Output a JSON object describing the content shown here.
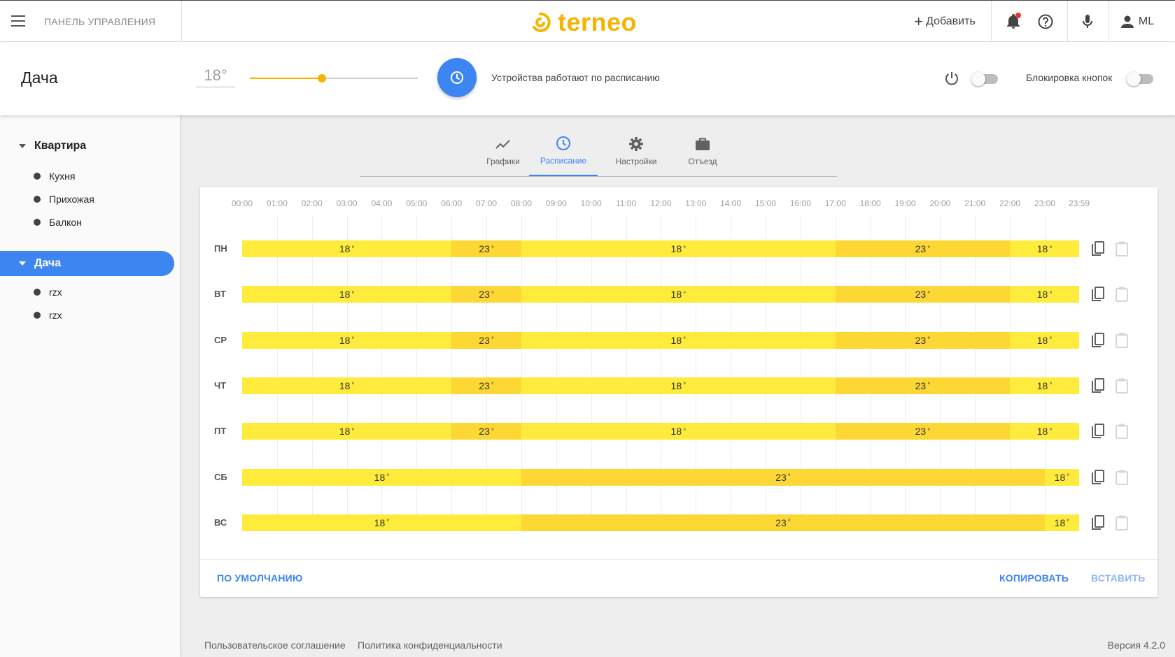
{
  "topbar": {
    "panel_title": "ПАНЕЛЬ УПРАВЛЕНИЯ",
    "brand": "terneo",
    "add_label": "Добавить",
    "user_initials": "ML"
  },
  "header": {
    "group_name": "Дача",
    "set_temperature": "18°",
    "temperature_slider_fraction": 0.43,
    "schedule_status": "Устройства работают по расписанию",
    "power_toggle_on": false,
    "button_lock_label": "Блокировка кнопок",
    "button_lock_on": false
  },
  "sidebar": {
    "groups": [
      {
        "name": "Квартира",
        "active": false,
        "devices": [
          "Кухня",
          "Прихожая",
          "Балкон"
        ]
      },
      {
        "name": "Дача",
        "active": true,
        "devices": [
          "rzx",
          "rzx"
        ]
      }
    ]
  },
  "tabs": [
    {
      "label": "Графики",
      "icon": "chart-icon",
      "active": false
    },
    {
      "label": "Расписание",
      "icon": "clock-icon",
      "active": true
    },
    {
      "label": "Настройки",
      "icon": "gear-icon",
      "active": false
    },
    {
      "label": "Отъезд",
      "icon": "suitcase-icon",
      "active": false
    }
  ],
  "schedule": {
    "hours": [
      "00:00",
      "01:00",
      "02:00",
      "03:00",
      "04:00",
      "05:00",
      "06:00",
      "07:00",
      "08:00",
      "09:00",
      "10:00",
      "11:00",
      "12:00",
      "13:00",
      "14:00",
      "15:00",
      "16:00",
      "17:00",
      "18:00",
      "19:00",
      "20:00",
      "21:00",
      "22:00",
      "23:00",
      "23:59"
    ],
    "colors": {
      "low": "#ffeb3b",
      "high": "#fdd835"
    },
    "days": [
      {
        "label": "ПН",
        "periods": [
          {
            "start": "00:00",
            "end": "06:00",
            "temp": "18"
          },
          {
            "start": "06:00",
            "end": "08:00",
            "temp": "23"
          },
          {
            "start": "08:00",
            "end": "17:00",
            "temp": "18"
          },
          {
            "start": "17:00",
            "end": "22:00",
            "temp": "23"
          },
          {
            "start": "22:00",
            "end": "23:59",
            "temp": "18"
          }
        ]
      },
      {
        "label": "ВТ",
        "periods": [
          {
            "start": "00:00",
            "end": "06:00",
            "temp": "18"
          },
          {
            "start": "06:00",
            "end": "08:00",
            "temp": "23"
          },
          {
            "start": "08:00",
            "end": "17:00",
            "temp": "18"
          },
          {
            "start": "17:00",
            "end": "22:00",
            "temp": "23"
          },
          {
            "start": "22:00",
            "end": "23:59",
            "temp": "18"
          }
        ]
      },
      {
        "label": "СР",
        "periods": [
          {
            "start": "00:00",
            "end": "06:00",
            "temp": "18"
          },
          {
            "start": "06:00",
            "end": "08:00",
            "temp": "23"
          },
          {
            "start": "08:00",
            "end": "17:00",
            "temp": "18"
          },
          {
            "start": "17:00",
            "end": "22:00",
            "temp": "23"
          },
          {
            "start": "22:00",
            "end": "23:59",
            "temp": "18"
          }
        ]
      },
      {
        "label": "ЧТ",
        "periods": [
          {
            "start": "00:00",
            "end": "06:00",
            "temp": "18"
          },
          {
            "start": "06:00",
            "end": "08:00",
            "temp": "23"
          },
          {
            "start": "08:00",
            "end": "17:00",
            "temp": "18"
          },
          {
            "start": "17:00",
            "end": "22:00",
            "temp": "23"
          },
          {
            "start": "22:00",
            "end": "23:59",
            "temp": "18"
          }
        ]
      },
      {
        "label": "ПТ",
        "periods": [
          {
            "start": "00:00",
            "end": "06:00",
            "temp": "18"
          },
          {
            "start": "06:00",
            "end": "08:00",
            "temp": "23"
          },
          {
            "start": "08:00",
            "end": "17:00",
            "temp": "18"
          },
          {
            "start": "17:00",
            "end": "22:00",
            "temp": "23"
          },
          {
            "start": "22:00",
            "end": "23:59",
            "temp": "18"
          }
        ]
      },
      {
        "label": "СБ",
        "periods": [
          {
            "start": "00:00",
            "end": "08:00",
            "temp": "18"
          },
          {
            "start": "08:00",
            "end": "23:00",
            "temp": "23"
          },
          {
            "start": "23:00",
            "end": "23:59",
            "temp": "18"
          }
        ]
      },
      {
        "label": "ВС",
        "periods": [
          {
            "start": "00:00",
            "end": "08:00",
            "temp": "18"
          },
          {
            "start": "08:00",
            "end": "23:00",
            "temp": "23"
          },
          {
            "start": "23:00",
            "end": "23:59",
            "temp": "18"
          }
        ]
      }
    ],
    "default_label": "ПО УМОЛЧАНИЮ",
    "copy_label": "КОПИРОВАТЬ",
    "paste_label": "ВСТАВИТЬ"
  },
  "footer": {
    "terms": "Пользовательское соглашение",
    "privacy": "Политика конфиденциальности",
    "version": "Версия 4.2.0"
  }
}
